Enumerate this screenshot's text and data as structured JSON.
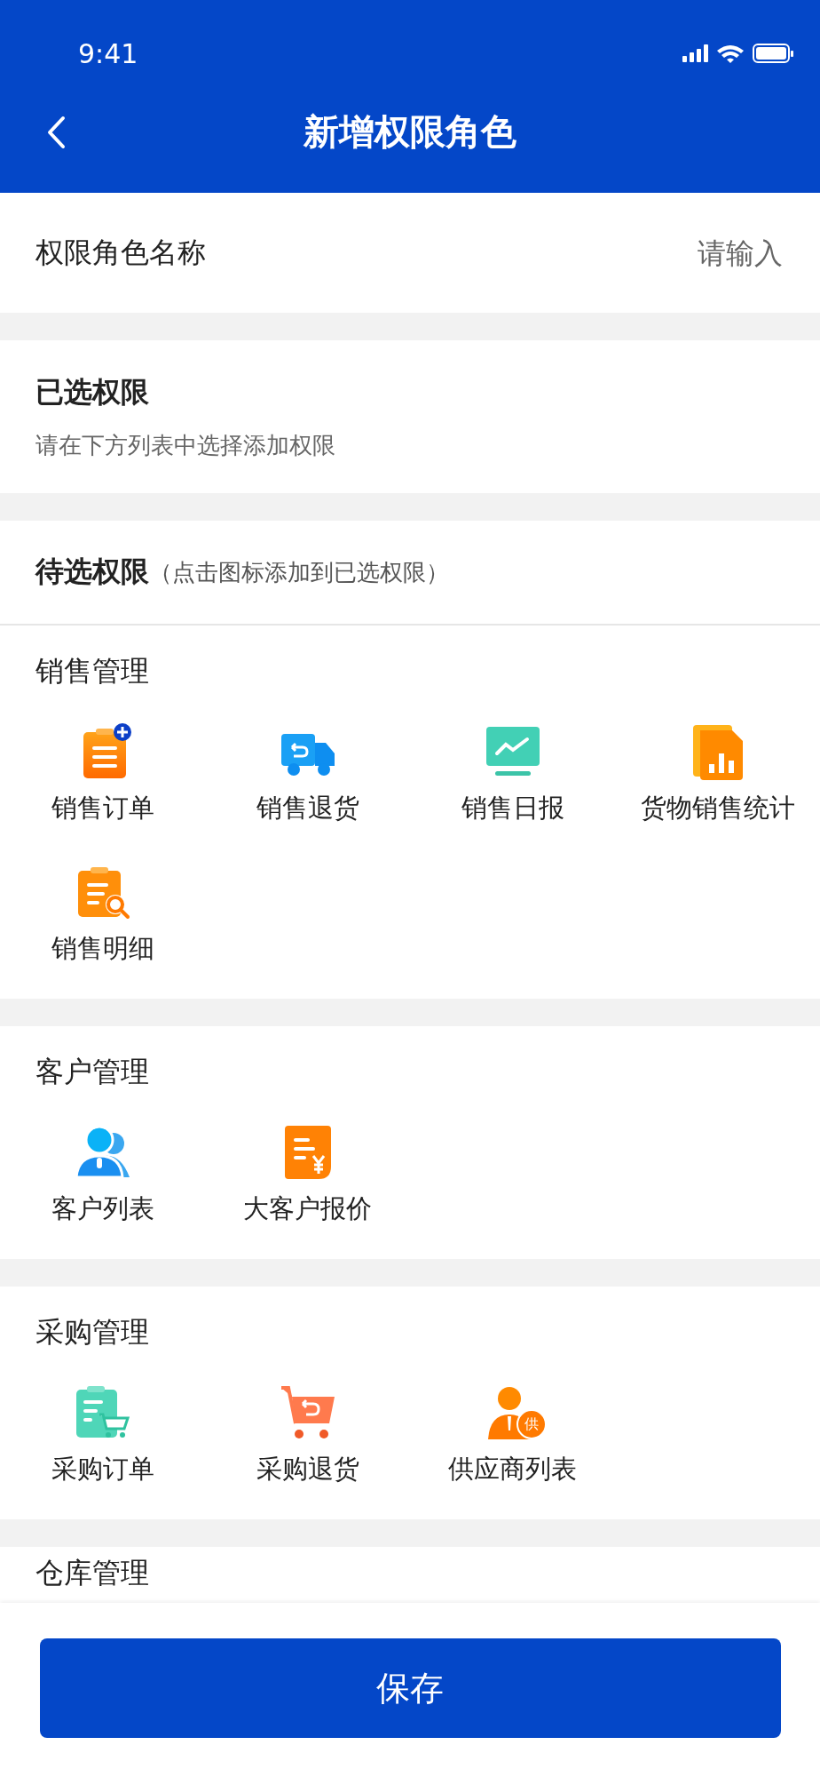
{
  "status_bar": {
    "time": "9:41"
  },
  "nav": {
    "title": "新增权限角色"
  },
  "name_field": {
    "label": "权限角色名称",
    "placeholder": "请输入"
  },
  "selected_section": {
    "title": "已选权限",
    "hint": "请在下方列表中选择添加权限"
  },
  "available_section": {
    "title": "待选权限",
    "note": "（点击图标添加到已选权限）"
  },
  "groups": [
    {
      "title": "销售管理",
      "items": [
        {
          "label": "销售订单",
          "kind": "clipboard-plus"
        },
        {
          "label": "销售退货",
          "kind": "truck"
        },
        {
          "label": "销售日报",
          "kind": "monitor"
        },
        {
          "label": "货物销售统计",
          "kind": "chart-doc"
        },
        {
          "label": "销售明细",
          "kind": "clipboard-search"
        }
      ]
    },
    {
      "title": "客户管理",
      "items": [
        {
          "label": "客户列表",
          "kind": "users"
        },
        {
          "label": "大客户报价",
          "kind": "price-doc"
        }
      ]
    },
    {
      "title": "采购管理",
      "items": [
        {
          "label": "采购订单",
          "kind": "clipboard-cart"
        },
        {
          "label": "采购退货",
          "kind": "cart-return"
        },
        {
          "label": "供应商列表",
          "kind": "supplier",
          "badge": "供"
        }
      ]
    },
    {
      "title": "仓库管理"
    }
  ],
  "footer": {
    "button": "保存"
  }
}
